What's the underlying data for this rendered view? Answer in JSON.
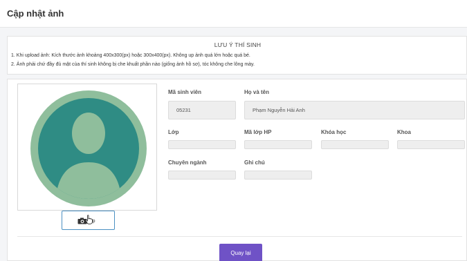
{
  "header": {
    "title": "Cập nhật ảnh"
  },
  "notice": {
    "title": "LƯU Ý THÍ SINH",
    "line1": "1. Khi upload ảnh: Kích thước ảnh khoảng 400x300(px) hoặc 300x400(px). Không up ảnh quá lớn hoặc quá bé.",
    "line2": "2. Ảnh phải chứ đầy đủ mặt của thí sinh không bị che khuất phần nào (giống ảnh hồ sơ), tóc không che lông mày."
  },
  "photo": {
    "avatar_icon": "user-silhouette-icon",
    "upload_label": "Up",
    "upload_icon": "camera-icon"
  },
  "colors": {
    "avatar_ring": "#8fbe9c",
    "avatar_inner": "#2f8c84",
    "avatar_silhouette": "#8fbe9c",
    "back_button": "#6f52c6",
    "upload_border": "#4a90c2"
  },
  "fields": {
    "student_id": {
      "label": "Mã sinh viên",
      "value": "05231"
    },
    "full_name": {
      "label": "Họ và tên",
      "value": "Phạm Nguyễn Hải Anh"
    },
    "class": {
      "label": "Lớp",
      "value": ""
    },
    "class_code": {
      "label": "Mã lớp HP",
      "value": ""
    },
    "course": {
      "label": "Khóa học",
      "value": ""
    },
    "faculty": {
      "label": "Khoa",
      "value": ""
    },
    "major": {
      "label": "Chuyên ngành",
      "value": ""
    },
    "note": {
      "label": "Ghi chú",
      "value": ""
    }
  },
  "actions": {
    "back_label": "Quay lại"
  }
}
